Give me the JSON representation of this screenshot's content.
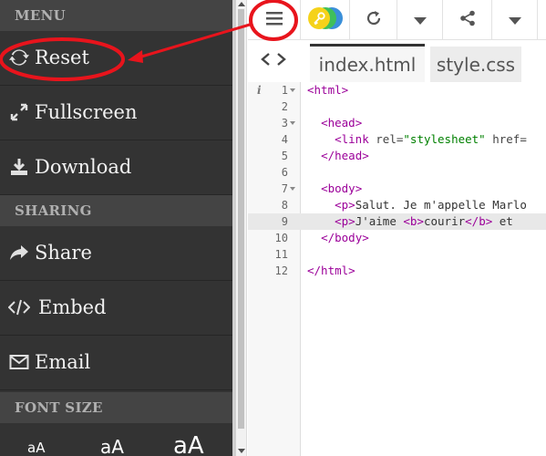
{
  "sidebar": {
    "menu_heading": "MENU",
    "items": [
      {
        "label": "Reset",
        "icon": "refresh-icon"
      },
      {
        "label": "Fullscreen",
        "icon": "expand-icon"
      },
      {
        "label": "Download",
        "icon": "download-icon"
      }
    ],
    "sharing_heading": "SHARING",
    "sharing_items": [
      {
        "label": "Share",
        "icon": "share-arrow-icon"
      },
      {
        "label": "Embed",
        "icon": "code-icon"
      },
      {
        "label": "Email",
        "icon": "envelope-icon"
      }
    ],
    "font_heading": "FONT SIZE",
    "font_sizes": [
      "aA",
      "aA",
      "aA"
    ]
  },
  "toolbar": {
    "buttons": [
      "menu-icon",
      "key-icon",
      "refresh-icon",
      "caret-down-icon",
      "share-nodes-icon",
      "caret-down-icon"
    ]
  },
  "tabs": {
    "active": "index.html",
    "inactive": "style.css"
  },
  "editor": {
    "line_numbers": [
      "1",
      "2",
      "3",
      "4",
      "5",
      "6",
      "7",
      "8",
      "9",
      "10",
      "11",
      "12"
    ],
    "lines": [
      "<html>",
      "",
      "  <head>",
      "    <link rel=\"stylesheet\" href=",
      "  </head>",
      "",
      "  <body>",
      "    <p>Salut. Je m'appelle Marlo",
      "    <p>J'aime <b>courir</b> et <",
      "  </body>",
      "",
      "</html>"
    ],
    "highlighted_line": 9
  },
  "colors": {
    "sidebar_bg": "#333333",
    "section_head_bg": "#444444",
    "annotation_red": "#e8141c",
    "tag_color": "#9b0099",
    "string_color": "#008000"
  }
}
